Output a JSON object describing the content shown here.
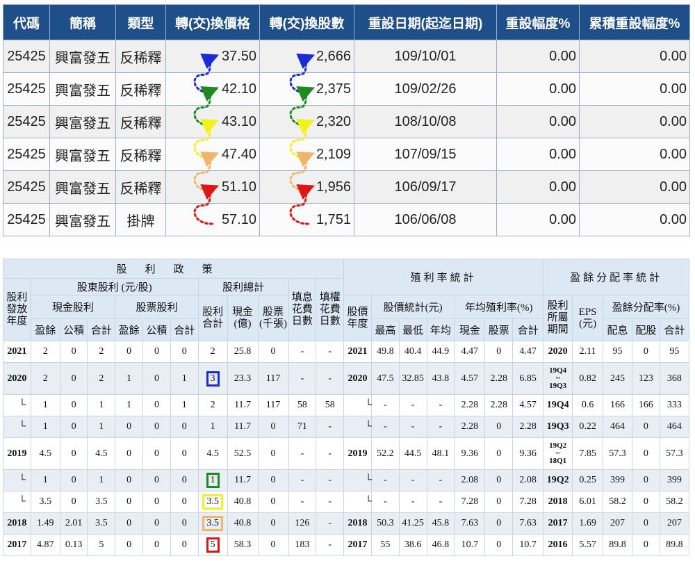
{
  "conversion_table": {
    "headers": [
      "代碼",
      "簡稱",
      "類型",
      "轉(交)換價格",
      "轉(交)換股數",
      "重設日期(起迄日期)",
      "重設幅度%",
      "累積重設幅度%"
    ],
    "rows": [
      {
        "code": "25425",
        "name": "興富發五",
        "type": "反稀釋",
        "price": "37.50",
        "shares": "2,666",
        "date": "109/10/01",
        "reset": "0.00",
        "cumulative": "0.00"
      },
      {
        "code": "25425",
        "name": "興富發五",
        "type": "反稀釋",
        "price": "42.10",
        "shares": "2,375",
        "date": "109/02/26",
        "reset": "0.00",
        "cumulative": "0.00"
      },
      {
        "code": "25425",
        "name": "興富發五",
        "type": "反稀釋",
        "price": "43.10",
        "shares": "2,320",
        "date": "108/10/08",
        "reset": "0.00",
        "cumulative": "0.00"
      },
      {
        "code": "25425",
        "name": "興富發五",
        "type": "反稀釋",
        "price": "47.40",
        "shares": "2,109",
        "date": "107/09/15",
        "reset": "0.00",
        "cumulative": "0.00"
      },
      {
        "code": "25425",
        "name": "興富發五",
        "type": "反稀釋",
        "price": "51.10",
        "shares": "1,956",
        "date": "106/09/17",
        "reset": "0.00",
        "cumulative": "0.00"
      },
      {
        "code": "25425",
        "name": "興富發五",
        "type": "掛牌",
        "price": "57.10",
        "shares": "1,751",
        "date": "106/06/08",
        "reset": "0.00",
        "cumulative": "0.00"
      }
    ],
    "arrow_colors": [
      "#1a2bd6",
      "#1f8a1f",
      "#f2f21a",
      "#f0b46a",
      "#e01515"
    ]
  },
  "dividend_table": {
    "group_titles": {
      "policy": "股利政策",
      "yield_stats": "殖利率統計",
      "payout_stats": "盈餘分配率統計"
    },
    "sub_titles": {
      "shareholder_dividend": "股東股利 (元/股)",
      "total_dividend": "股利總計",
      "cash_dividend": "現金股利",
      "stock_dividend": "股票股利",
      "price_stats": "股價統計(元)",
      "annual_yield": "年均殖利率(%)",
      "payout_ratio": "盈餘分配率(%)"
    },
    "column_labels": {
      "year": "股利發放年度",
      "ex_div_days": "填息花費日數",
      "ex_right_days": "填權花費日數",
      "price_year": "股價年度",
      "period": "股利所屬期間",
      "eps": "EPS (元)",
      "total_sum": "股利合計",
      "total_cash": "現金 (億)",
      "total_stock": "股票 (千張)",
      "surplus": "盈餘",
      "reserve": "公積",
      "sum": "合計",
      "high": "最高",
      "low": "最低",
      "avg": "年均",
      "cash": "現金",
      "stock": "股票",
      "payout_dist": "配息",
      "payout_stock": "配股"
    },
    "rows": [
      {
        "year": "2021",
        "cs": "2",
        "cr": "0",
        "ct": "2",
        "ss": "0",
        "sr": "0",
        "st": "0",
        "tsum": "2",
        "tcash": "25.8",
        "tstock": "0",
        "d1": "-",
        "d2": "-",
        "py": "2021",
        "hi": "49.8",
        "lo": "40.4",
        "avg": "44.9",
        "yc": "4.47",
        "ys": "0",
        "yt": "4.47",
        "per": "2020",
        "eps": "2.11",
        "pc": "95",
        "ps": "0",
        "pt": "95"
      },
      {
        "year": "2020",
        "cs": "2",
        "cr": "0",
        "ct": "2",
        "ss": "1",
        "sr": "0",
        "st": "1",
        "tsum": "3",
        "tcash": "23.3",
        "tstock": "117",
        "d1": "-",
        "d2": "-",
        "py": "2020",
        "hi": "47.5",
        "lo": "32.85",
        "avg": "43.8",
        "yc": "4.57",
        "ys": "2.28",
        "yt": "6.85",
        "per": "19Q4 ~ 19Q3",
        "eps": "0.82",
        "pc": "245",
        "ps": "123",
        "pt": "368"
      },
      {
        "year": "└",
        "cs": "1",
        "cr": "0",
        "ct": "1",
        "ss": "1",
        "sr": "0",
        "st": "1",
        "tsum": "2",
        "tcash": "11.7",
        "tstock": "117",
        "d1": "58",
        "d2": "58",
        "py": "└",
        "hi": "-",
        "lo": "-",
        "avg": "-",
        "yc": "2.28",
        "ys": "2.28",
        "yt": "4.57",
        "per": "19Q4",
        "eps": "0.6",
        "pc": "166",
        "ps": "166",
        "pt": "333"
      },
      {
        "year": "└",
        "cs": "1",
        "cr": "0",
        "ct": "1",
        "ss": "0",
        "sr": "0",
        "st": "0",
        "tsum": "1",
        "tcash": "11.7",
        "tstock": "0",
        "d1": "71",
        "d2": "-",
        "py": "└",
        "hi": "-",
        "lo": "-",
        "avg": "-",
        "yc": "2.28",
        "ys": "0",
        "yt": "2.28",
        "per": "19Q3",
        "eps": "0.22",
        "pc": "464",
        "ps": "0",
        "pt": "464"
      },
      {
        "year": "2019",
        "cs": "4.5",
        "cr": "0",
        "ct": "4.5",
        "ss": "0",
        "sr": "0",
        "st": "0",
        "tsum": "4.5",
        "tcash": "52.5",
        "tstock": "0",
        "d1": "-",
        "d2": "-",
        "py": "2019",
        "hi": "52.2",
        "lo": "44.5",
        "avg": "48.1",
        "yc": "9.36",
        "ys": "0",
        "yt": "9.36",
        "per": "19Q2 ~ 18Q1",
        "eps": "7.85",
        "pc": "57.3",
        "ps": "0",
        "pt": "57.3"
      },
      {
        "year": "└",
        "cs": "1",
        "cr": "0",
        "ct": "1",
        "ss": "0",
        "sr": "0",
        "st": "0",
        "tsum": "1",
        "tcash": "11.7",
        "tstock": "0",
        "d1": "-",
        "d2": "-",
        "py": "└",
        "hi": "-",
        "lo": "-",
        "avg": "-",
        "yc": "2.08",
        "ys": "0",
        "yt": "2.08",
        "per": "19Q2",
        "eps": "0.25",
        "pc": "399",
        "ps": "0",
        "pt": "399"
      },
      {
        "year": "└",
        "cs": "3.5",
        "cr": "0",
        "ct": "3.5",
        "ss": "0",
        "sr": "0",
        "st": "0",
        "tsum": "3.5",
        "tcash": "40.8",
        "tstock": "0",
        "d1": "-",
        "d2": "-",
        "py": "└",
        "hi": "-",
        "lo": "-",
        "avg": "-",
        "yc": "7.28",
        "ys": "0",
        "yt": "7.28",
        "per": "2018",
        "eps": "6.01",
        "pc": "58.2",
        "ps": "0",
        "pt": "58.2"
      },
      {
        "year": "2018",
        "cs": "1.49",
        "cr": "2.01",
        "ct": "3.5",
        "ss": "0",
        "sr": "0",
        "st": "0",
        "tsum": "3.5",
        "tcash": "40.8",
        "tstock": "0",
        "d1": "126",
        "d2": "-",
        "py": "2018",
        "hi": "50.3",
        "lo": "41.25",
        "avg": "45.8",
        "yc": "7.63",
        "ys": "0",
        "yt": "7.63",
        "per": "2017",
        "eps": "1.69",
        "pc": "207",
        "ps": "0",
        "pt": "207"
      },
      {
        "year": "2017",
        "cs": "4.87",
        "cr": "0.13",
        "ct": "5",
        "ss": "0",
        "sr": "0",
        "st": "0",
        "tsum": "5",
        "tcash": "58.3",
        "tstock": "0",
        "d1": "183",
        "d2": "-",
        "py": "2017",
        "hi": "55",
        "lo": "38.6",
        "avg": "46.8",
        "yc": "10.7",
        "ys": "0",
        "yt": "10.7",
        "per": "2016",
        "eps": "5.57",
        "pc": "89.8",
        "ps": "0",
        "pt": "89.8"
      }
    ],
    "highlight_boxes": [
      {
        "row": 1,
        "color": "#1a2bd6"
      },
      {
        "row": 5,
        "color": "#1f8a1f"
      },
      {
        "row": 6,
        "color": "#f2f21a"
      },
      {
        "row": 7,
        "color": "#f0b46a"
      },
      {
        "row": 8,
        "color": "#e01515"
      }
    ]
  }
}
